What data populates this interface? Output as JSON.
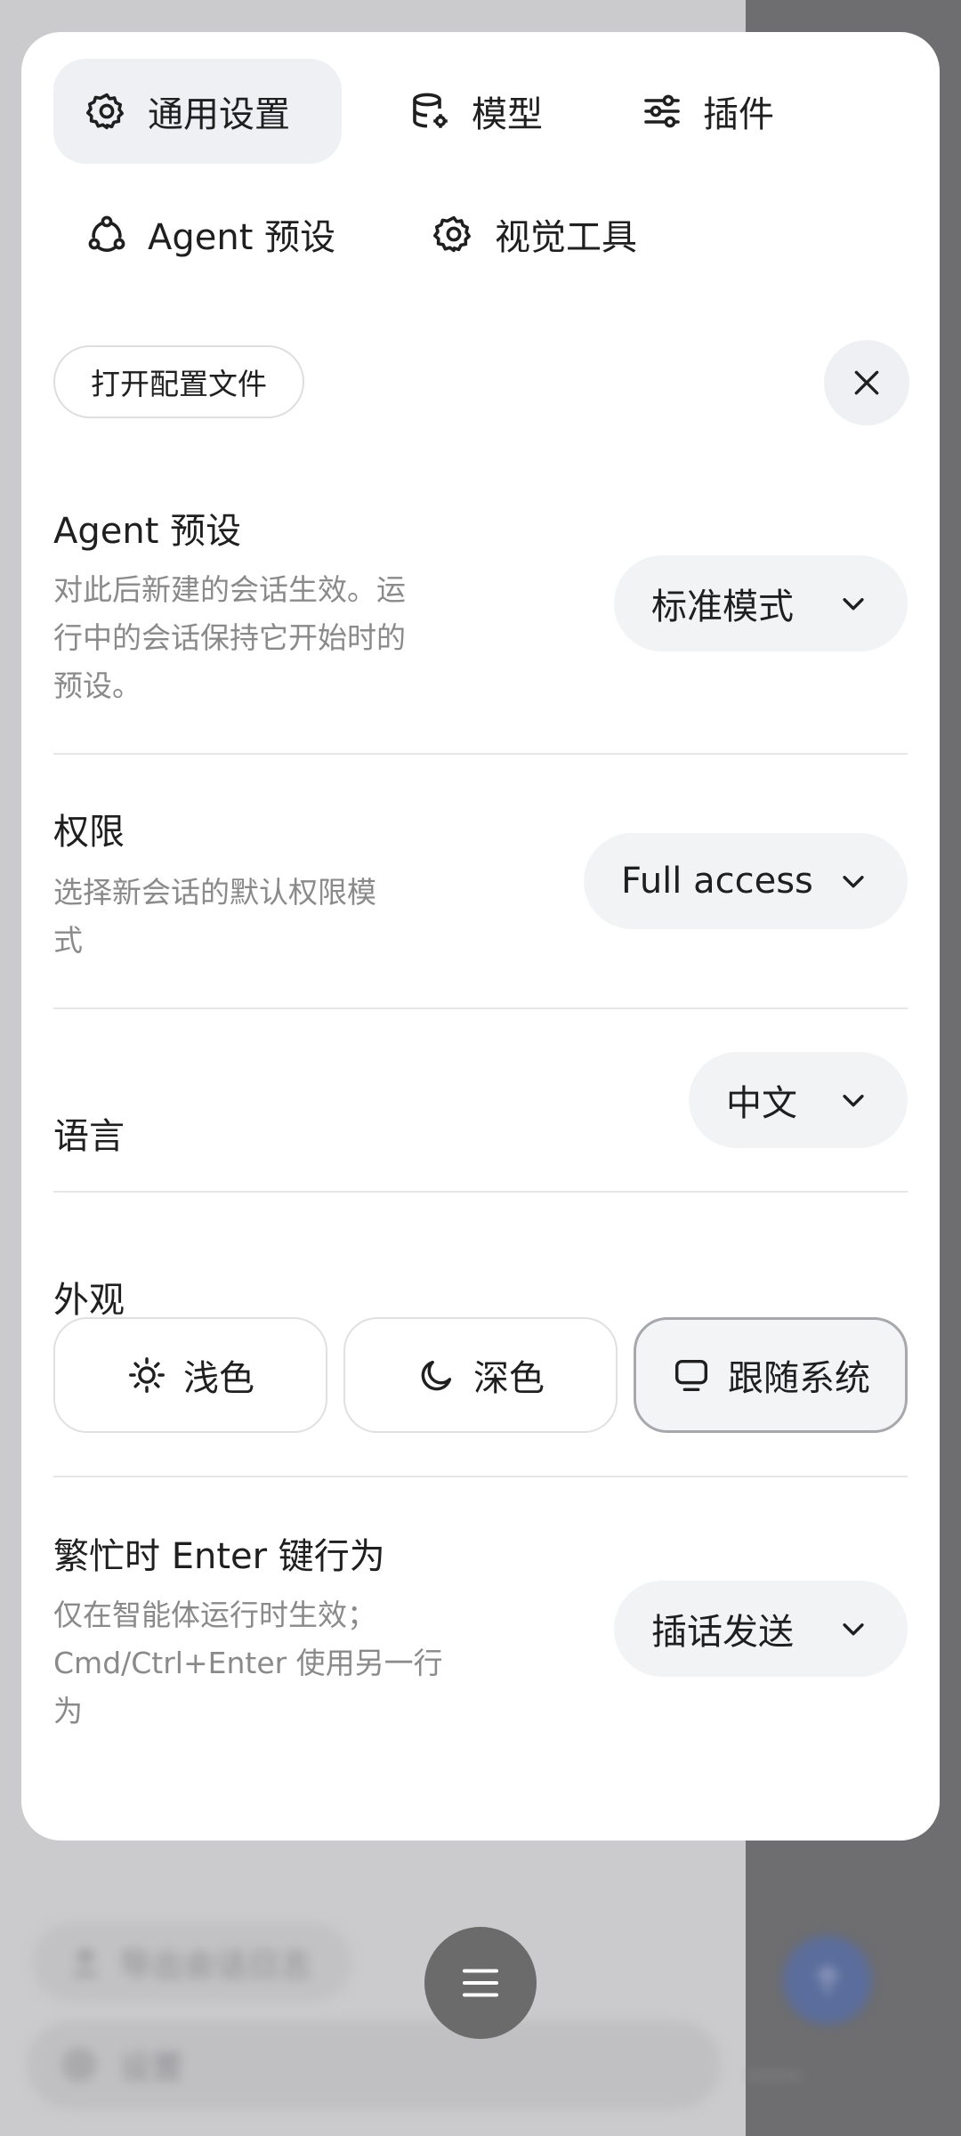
{
  "tabs": [
    {
      "label": "通用设置",
      "icon": "gear-icon",
      "active": true
    },
    {
      "label": "模型",
      "icon": "database-gear-icon",
      "active": false
    },
    {
      "label": "插件",
      "icon": "sliders-icon",
      "active": false
    },
    {
      "label": "Agent 预设",
      "icon": "agent-icon",
      "active": false
    },
    {
      "label": "视觉工具",
      "icon": "gear-icon",
      "active": false
    }
  ],
  "open_config_label": "打开配置文件",
  "settings": {
    "agent_preset": {
      "title": "Agent 预设",
      "desc_lines": [
        "对此后新建的会话生效。运",
        "行中的会话保持它开始时的",
        "预设。"
      ],
      "value": "标准模式"
    },
    "permission": {
      "title": "权限",
      "desc_lines": [
        "选择新会话的默认权限模",
        "式"
      ],
      "value": "Full access"
    },
    "language": {
      "title": "语言",
      "value": "中文"
    },
    "appearance": {
      "title": "外观",
      "options": [
        {
          "label": "浅色",
          "icon": "sun-icon"
        },
        {
          "label": "深色",
          "icon": "moon-icon"
        },
        {
          "label": "跟随系统",
          "icon": "monitor-icon",
          "selected": true
        }
      ]
    },
    "busy_enter": {
      "title": "繁忙时 Enter 键行为",
      "desc_lines": [
        "仅在智能体运行时生效；",
        "Cmd/Ctrl+Enter 使用另一行",
        "为"
      ],
      "value": "插话发送"
    }
  },
  "background": {
    "export_label": "导出会话日志",
    "settings_label": "设置"
  },
  "colors": {
    "panel_bg": "#ffffff",
    "active_tab_bg": "#eef0f3",
    "select_bg": "#f2f3f5",
    "muted_text": "#8a8a8a",
    "fab_bg": "#6b6b6b"
  }
}
